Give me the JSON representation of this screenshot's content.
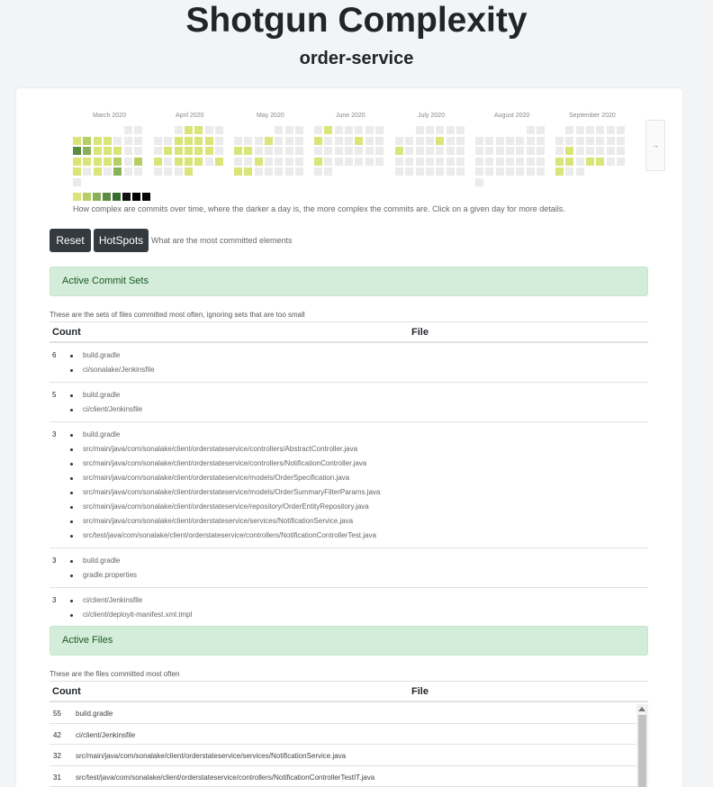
{
  "header": {
    "title": "Shotgun Complexity",
    "subtitle": "order-service"
  },
  "heatmap": {
    "months": [
      "March 2020",
      "April 2020",
      "May 2020",
      "June 2020",
      "July 2020",
      "August 2020",
      "September 2020"
    ],
    "next_label": "→",
    "description": "How complex are commits over time, where the darker a day is, the more complex the commits are. Click on a given day for more details.",
    "legend_colors": [
      "#d9e479",
      "#b5cf66",
      "#8ab05a",
      "#5d8a43",
      "#3a6b30",
      "#111111",
      "#000000",
      "#050505"
    ],
    "empty_color": "#ebebeb"
  },
  "buttons": {
    "reset": "Reset",
    "hotspots": "HotSpots",
    "hint": "What are the most committed elements"
  },
  "commit_sets": {
    "title": "Active Commit Sets",
    "description": "These are the sets of files committed most often, ignoring sets that are too small",
    "header_count": "Count",
    "header_file": "File",
    "rows": [
      {
        "count": "6",
        "files": [
          "build.gradle",
          "ci/sonalake/Jenkinsfile"
        ]
      },
      {
        "count": "5",
        "files": [
          "build.gradle",
          "ci/client/Jenkinsfile"
        ]
      },
      {
        "count": "3",
        "files": [
          "build.gradle",
          "src/main/java/com/sonalake/client/orderstateservice/controllers/AbstractController.java",
          "src/main/java/com/sonalake/client/orderstateservice/controllers/NotificationController.java",
          "src/main/java/com/sonalake/client/orderstateservice/models/OrderSpecification.java",
          "src/main/java/com/sonalake/client/orderstateservice/models/OrderSummaryFilterParams.java",
          "src/main/java/com/sonalake/client/orderstateservice/repository/OrderEntityRepository.java",
          "src/main/java/com/sonalake/client/orderstateservice/services/NotificationService.java",
          "src/test/java/com/sonalake/client/orderstateservice/controllers/NotificationControllerTest.java"
        ]
      },
      {
        "count": "3",
        "files": [
          "build.gradle",
          "gradle.properties"
        ]
      },
      {
        "count": "3",
        "files": [
          "ci/client/Jenkinsfile",
          "ci/client/deployit-manifest.xml.tmpl"
        ]
      }
    ]
  },
  "active_files": {
    "title": "Active Files",
    "description": "These are the files committed most often",
    "header_count": "Count",
    "header_file": "File",
    "rows": [
      {
        "count": "55",
        "file": "build.gradle"
      },
      {
        "count": "42",
        "file": "ci/client/Jenkinsfile"
      },
      {
        "count": "32",
        "file": "src/main/java/com/sonalake/client/orderstateservice/services/NotificationService.java"
      },
      {
        "count": "31",
        "file": "src/test/java/com/sonalake/client/orderstateservice/controllers/NotificationControllerTestIT.java"
      }
    ]
  }
}
